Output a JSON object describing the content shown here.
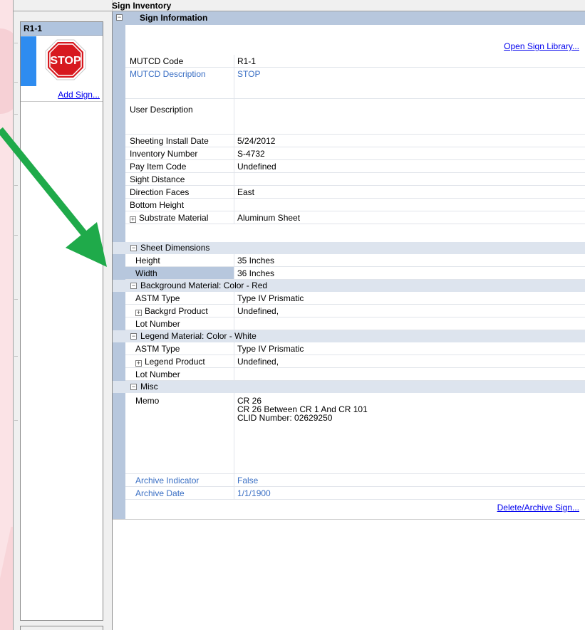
{
  "window": {
    "title": "Sign Inventory"
  },
  "sign_list": {
    "header": "R1-1",
    "items": [
      {
        "stop_text": "STOP",
        "icon": "stop-sign-icon"
      }
    ],
    "add_link": "Add Sign..."
  },
  "grid": {
    "section_title": "Sign Information",
    "open_library_link": "Open Sign Library...",
    "rows": {
      "mutcd_code": {
        "name": "MUTCD Code",
        "value": "R1-1"
      },
      "mutcd_description": {
        "name": "MUTCD Description",
        "value": "STOP"
      },
      "user_description": {
        "name": "User Description",
        "value": ""
      },
      "sheeting_install_date": {
        "name": "Sheeting Install Date",
        "value": "5/24/2012"
      },
      "inventory_number": {
        "name": "Inventory Number",
        "value": "S-4732"
      },
      "pay_item_code": {
        "name": "Pay Item Code",
        "value": "Undefined"
      },
      "sight_distance": {
        "name": "Sight Distance",
        "value": ""
      },
      "direction_faces": {
        "name": "Direction Faces",
        "value": "East"
      },
      "bottom_height": {
        "name": "Bottom Height",
        "value": ""
      },
      "substrate_material": {
        "name": "Substrate Material",
        "value": "Aluminum Sheet"
      }
    },
    "sheet_dimensions": {
      "label": "Sheet Dimensions",
      "height": {
        "name": "Height",
        "value": "35 Inches"
      },
      "width": {
        "name": "Width",
        "value": "36 Inches"
      }
    },
    "background_material": {
      "label": "Background Material: Color - Red",
      "astm_type": {
        "name": "ASTM Type",
        "value": "Type IV Prismatic"
      },
      "product": {
        "name": "Backgrd Product",
        "value": "Undefined,"
      },
      "lot_number": {
        "name": "Lot Number",
        "value": ""
      }
    },
    "legend_material": {
      "label": "Legend Material: Color - White",
      "astm_type": {
        "name": "ASTM Type",
        "value": "Type IV Prismatic"
      },
      "product": {
        "name": "Legend Product",
        "value": "Undefined,"
      },
      "lot_number": {
        "name": "Lot Number",
        "value": ""
      }
    },
    "misc": {
      "label": "Misc",
      "memo": {
        "name": "Memo",
        "value": "CR 26\nCR 26 Between CR 1 And CR 101\nCLID Number:  02629250"
      },
      "archive_indicator": {
        "name": "Archive Indicator",
        "value": "False"
      },
      "archive_date": {
        "name": "Archive Date",
        "value": "1/1/1900"
      }
    },
    "delete_link": "Delete/Archive Sign..."
  },
  "colors": {
    "category_bg": "#dde4ee",
    "gutter": "#b7c7dd",
    "selected_sign": "#2e8cf0",
    "readonly_text": "#3a6fc4",
    "arrow": "#1faa4a",
    "stop_red": "#d7191f"
  }
}
